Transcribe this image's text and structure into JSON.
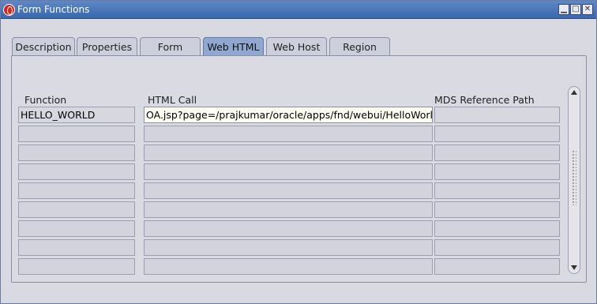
{
  "window": {
    "title": "Form Functions",
    "minimize": "▁",
    "maximize": "□",
    "close": "✕"
  },
  "tabs": [
    {
      "label": "Description",
      "active": false
    },
    {
      "label": "Properties",
      "active": false
    },
    {
      "label": "Form",
      "active": false
    },
    {
      "label": "Web HTML",
      "active": true
    },
    {
      "label": "Web Host",
      "active": false
    },
    {
      "label": "Region",
      "active": false
    }
  ],
  "columns": {
    "function": "Function",
    "html_call": "HTML Call",
    "mds_path": "MDS Reference Path"
  },
  "rows": [
    {
      "function": "HELLO_WORLD",
      "html_call": "OA.jsp?page=/prajkumar/oracle/apps/fnd/webui/HelloWorldPG",
      "mds_path": ""
    },
    {
      "function": "",
      "html_call": "",
      "mds_path": ""
    },
    {
      "function": "",
      "html_call": "",
      "mds_path": ""
    },
    {
      "function": "",
      "html_call": "",
      "mds_path": ""
    },
    {
      "function": "",
      "html_call": "",
      "mds_path": ""
    },
    {
      "function": "",
      "html_call": "",
      "mds_path": ""
    },
    {
      "function": "",
      "html_call": "",
      "mds_path": ""
    },
    {
      "function": "",
      "html_call": "",
      "mds_path": ""
    },
    {
      "function": "",
      "html_call": "",
      "mds_path": ""
    }
  ],
  "colors": {
    "titlebar": "#4a77b8",
    "active_tab": "#90a8cf",
    "editable_field": "#fffff4"
  }
}
